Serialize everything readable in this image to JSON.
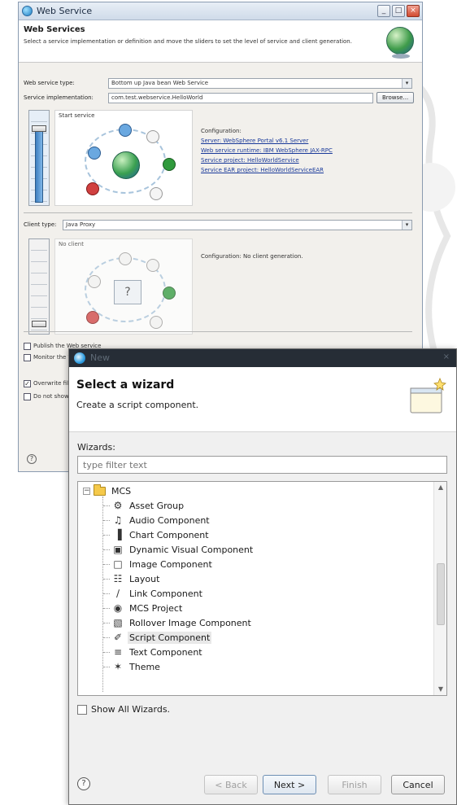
{
  "web_service": {
    "title": "Web Service",
    "heading": "Web Services",
    "description": "Select a service implementation or definition and move the sliders to set the level of service and client generation.",
    "service_type_label": "Web service type:",
    "service_type_value": "Bottom up Java bean Web Service",
    "impl_label": "Service implementation:",
    "impl_value": "com.test.webservice.HelloWorld",
    "browse_label": "Browse...",
    "service_slider_label": "Start service",
    "service_config": {
      "title": "Configuration:",
      "links": [
        "Server: WebSphere Portal v6.1 Server",
        "Web service runtime: IBM WebSphere JAX-RPC",
        "Service project: HelloWorldService",
        "Service EAR project: HelloWorldServiceEAR"
      ]
    },
    "client_type_label": "Client type:",
    "client_type_value": "Java Proxy",
    "client_slider_label": "No client",
    "client_config": "Configuration: No client generation.",
    "checkboxes": [
      "Publish the Web service",
      "Monitor the Web service",
      "Overwrite files without warning",
      "Do not show"
    ],
    "help_glyph": "?"
  },
  "new_wizard": {
    "title": "New",
    "close_glyph": "×",
    "banner_title": "Select a wizard",
    "banner_desc": "Create a script component.",
    "wizards_label": "Wizards:",
    "filter_placeholder": "type filter text",
    "root_folder": "MCS",
    "items": [
      {
        "label": "Asset Group",
        "icon": "asset-group-icon",
        "glyph": "⚙"
      },
      {
        "label": "Audio Component",
        "icon": "audio-icon",
        "glyph": "♫"
      },
      {
        "label": "Chart Component",
        "icon": "chart-icon",
        "glyph": "▐"
      },
      {
        "label": "Dynamic Visual Component",
        "icon": "dynamic-visual-icon",
        "glyph": "▣"
      },
      {
        "label": "Image Component",
        "icon": "image-icon",
        "glyph": "□"
      },
      {
        "label": "Layout",
        "icon": "layout-icon",
        "glyph": "☷"
      },
      {
        "label": "Link Component",
        "icon": "link-icon",
        "glyph": "∕"
      },
      {
        "label": "MCS Project",
        "icon": "mcs-project-icon",
        "glyph": "◉"
      },
      {
        "label": "Rollover Image Component",
        "icon": "rollover-image-icon",
        "glyph": "▧"
      },
      {
        "label": "Script Component",
        "icon": "script-icon",
        "glyph": "✐"
      },
      {
        "label": "Text Component",
        "icon": "text-icon",
        "glyph": "≡"
      },
      {
        "label": "Theme",
        "icon": "theme-icon",
        "glyph": "✶"
      }
    ],
    "selected_item": "Script Component",
    "show_all_label": "Show All Wizards.",
    "help_glyph": "?",
    "buttons": {
      "back": "< Back",
      "next": "Next >",
      "finish": "Finish",
      "cancel": "Cancel"
    },
    "colors": {
      "titlebar": "#262d36",
      "selection": "#e8e8e8"
    }
  }
}
